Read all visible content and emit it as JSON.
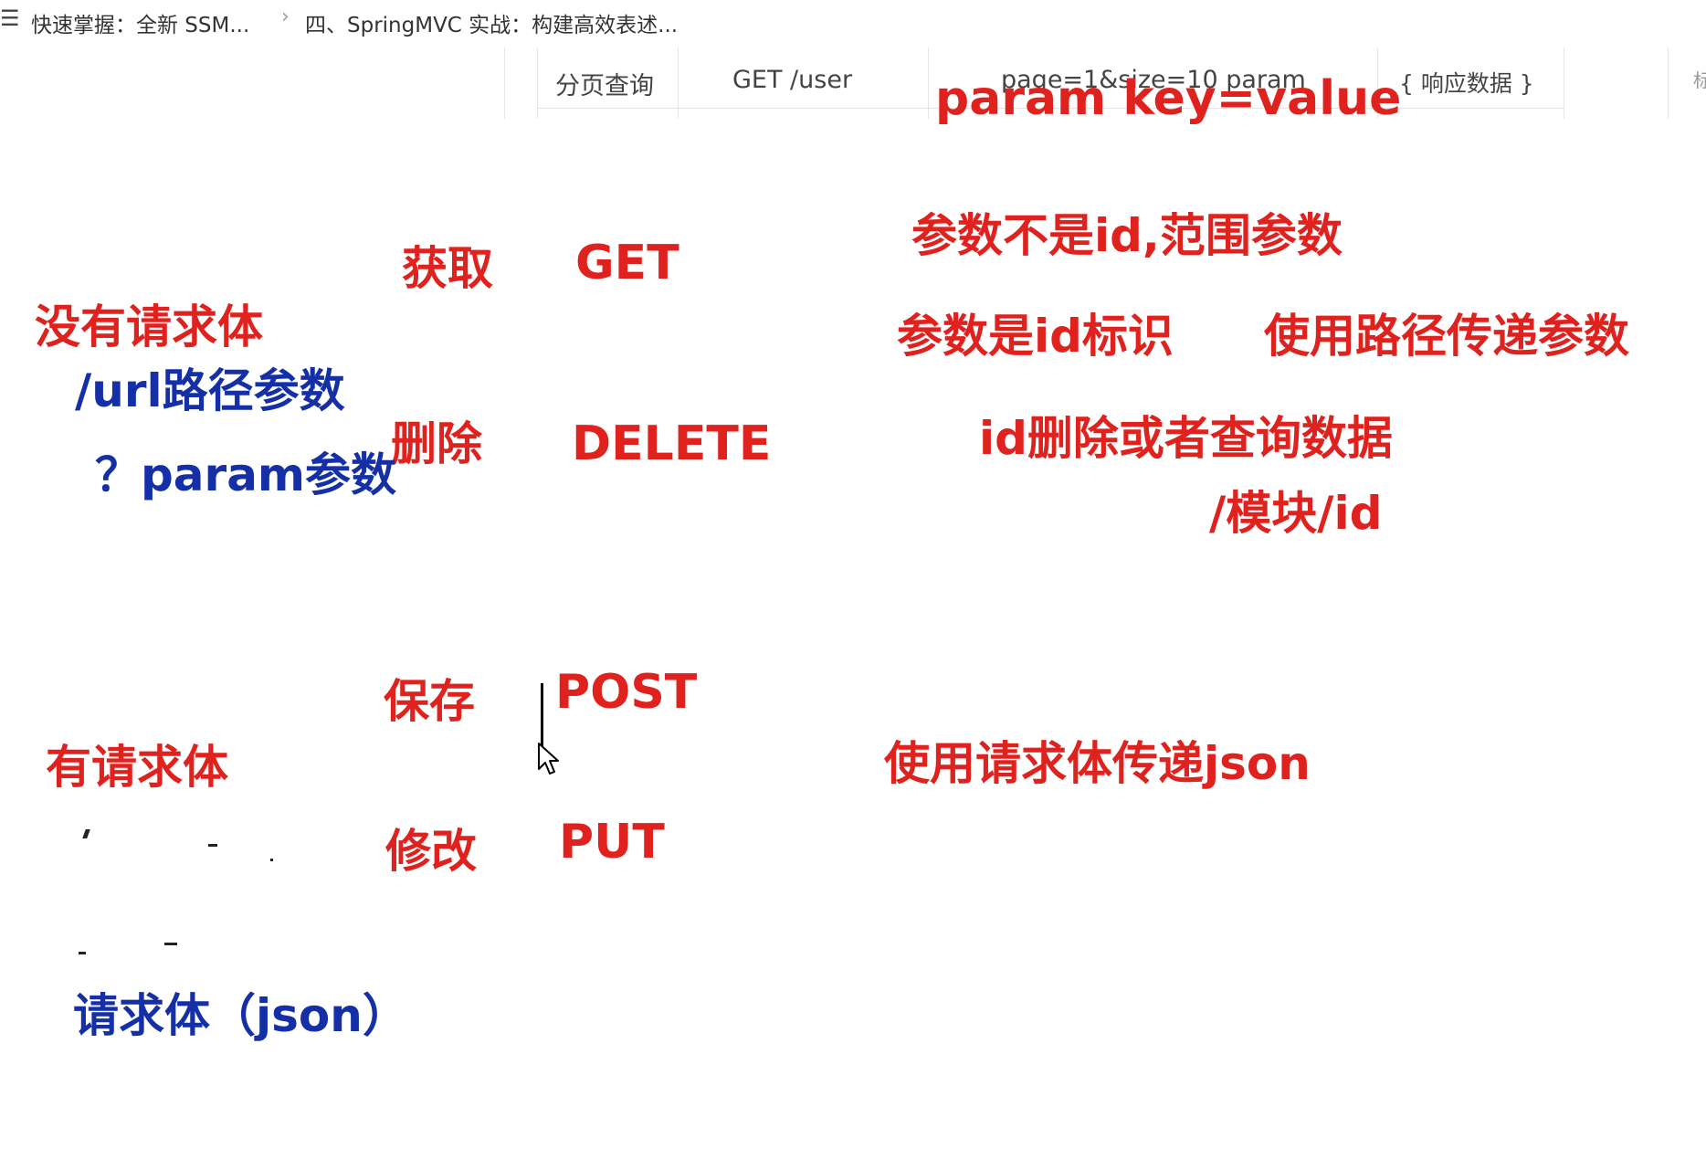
{
  "breadcrumb": {
    "menu_icon": "☰",
    "items": [
      "快速掌握：全新 SSM...",
      "四、SpringMVC 实战：构建高效表述..."
    ],
    "separator": "›"
  },
  "table": {
    "cells": [
      "分页查询",
      "GET  /user",
      "page=1&size=10 param",
      "{ 响应数据 }",
      "标"
    ]
  },
  "annotations": {
    "param_kv": "param   key=value",
    "get_cn": "获取",
    "get": "GET",
    "delete_cn": "删除",
    "delete": "DELETE",
    "save_cn": "保存",
    "post": "POST",
    "update_cn": "修改",
    "put": "PUT",
    "no_body": "没有请求体",
    "url_path_param": "/url路径参数",
    "query_param": "？param参数",
    "has_body": "有请求体",
    "body_json": "请求体（json）",
    "range_param": "参数不是id,范围参数",
    "id_param": "参数是id标识",
    "path_transfer": "使用路径传递参数",
    "id_delete_query": "id删除或者查询数据",
    "module_id": "/模块/id",
    "json_body_transfer": "使用请求体传递json"
  },
  "colors": {
    "red": "#e0221f",
    "blue": "#1530a6"
  },
  "icons": [
    "menu-icon",
    "chevron-right-icon",
    "mouse-cursor-icon"
  ]
}
